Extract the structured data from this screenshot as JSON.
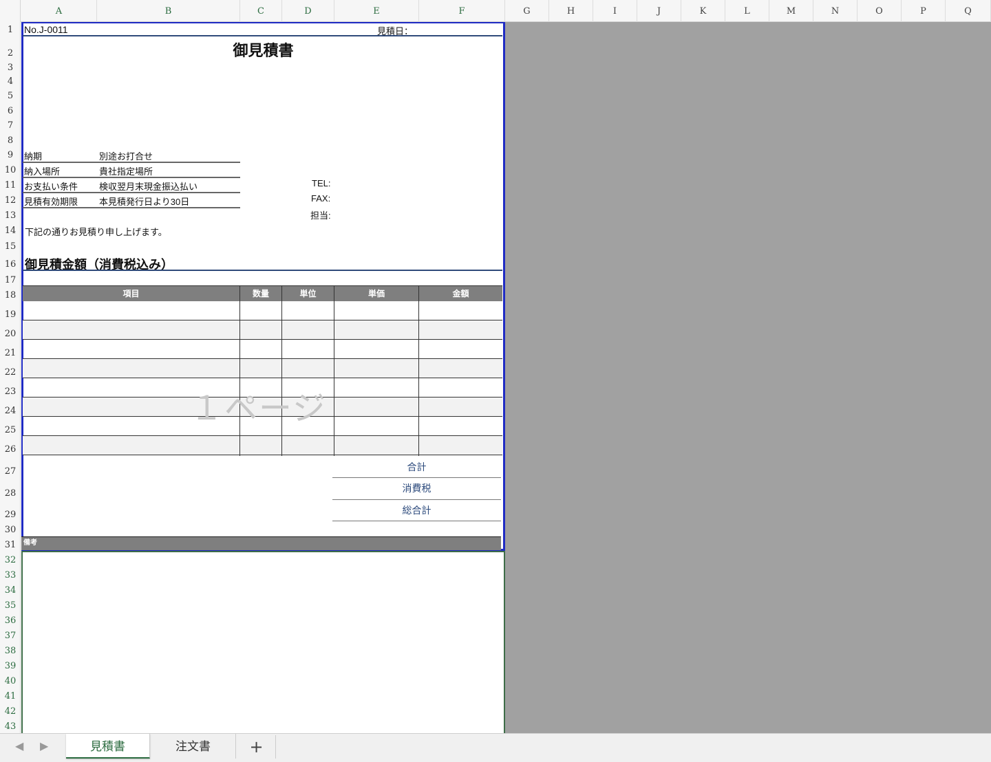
{
  "columns": [
    "A",
    "B",
    "C",
    "D",
    "E",
    "F",
    "G",
    "H",
    "I",
    "J",
    "K",
    "L",
    "M",
    "N",
    "O",
    "P",
    "Q"
  ],
  "rows": [
    "1",
    "2",
    "3",
    "4",
    "5",
    "6",
    "7",
    "8",
    "9",
    "10",
    "11",
    "12",
    "13",
    "14",
    "15",
    "16",
    "17",
    "18",
    "19",
    "20",
    "21",
    "22",
    "23",
    "24",
    "25",
    "26",
    "27",
    "28",
    "29",
    "30",
    "31",
    "32",
    "33",
    "34",
    "35",
    "36",
    "37",
    "38",
    "39",
    "40",
    "41",
    "42",
    "43"
  ],
  "doc": {
    "number": "No.J-0011",
    "date_label": "見積日：",
    "title": "御見積書",
    "terms": [
      {
        "label": "納期",
        "value": "別途お打合せ"
      },
      {
        "label": "納入場所",
        "value": "貴社指定場所"
      },
      {
        "label": "お支払い条件",
        "value": "検収翌月末現金振込払い"
      },
      {
        "label": "見積有効期限",
        "value": "本見積発行日より30日"
      }
    ],
    "tel_label": "TEL:",
    "fax_label": "FAX:",
    "contact_label": "担当:",
    "intro": "下記の通りお見積り申し上げます。",
    "amount_heading": "御見積金額（消費税込み）",
    "table_headers": [
      "項目",
      "数量",
      "単位",
      "単価",
      "金額"
    ],
    "watermark": "１ページ",
    "subtotal_label": "合計",
    "tax_label": "消費税",
    "total_label": "総合計",
    "remarks_label": "備考"
  },
  "tabs": {
    "prev_icon": "◀",
    "next_icon": "▶",
    "sheet1": "見積書",
    "sheet2": "注文書",
    "add": "+"
  },
  "colors": {
    "accent": "#2b6b3f",
    "print_border": "#1f2bc4",
    "header_fill": "#7f7f7f"
  }
}
